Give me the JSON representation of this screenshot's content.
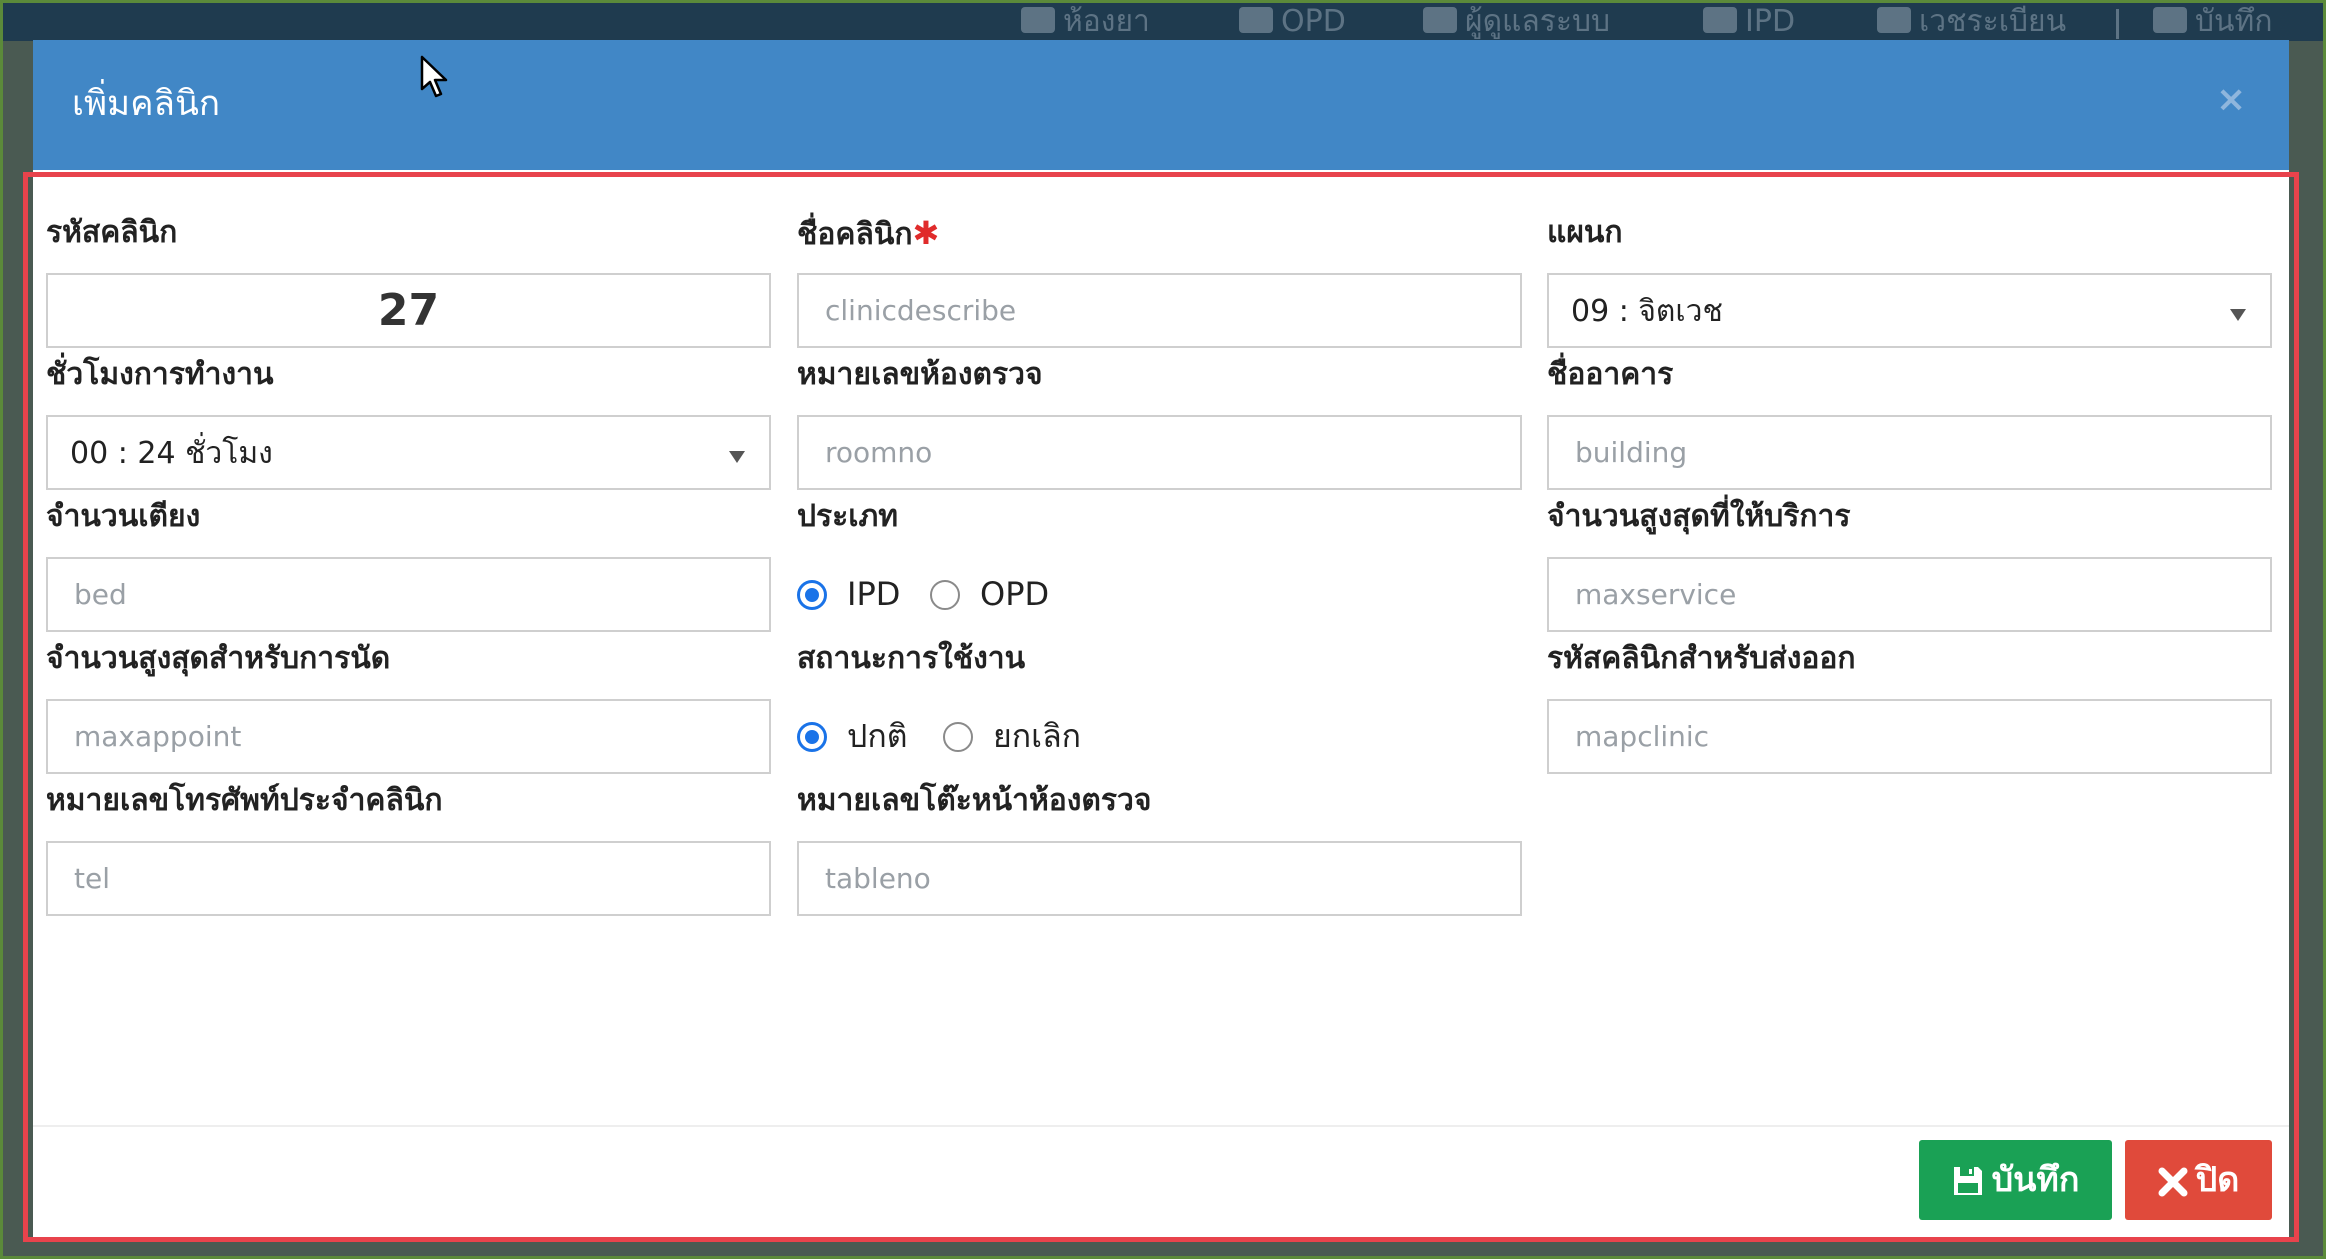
{
  "background": {
    "nav": [
      {
        "label": "ห้องยา",
        "icon": "medical-icon"
      },
      {
        "label": "OPD",
        "icon": "users-icon"
      },
      {
        "label": "ผู้ดูแลระบบ",
        "icon": "gears-icon"
      },
      {
        "label": "IPD",
        "icon": "bed-icon"
      },
      {
        "label": "เวชระเบียน",
        "icon": "card-icon"
      },
      {
        "label": "บันทึก",
        "icon": "save-icon"
      }
    ]
  },
  "modal": {
    "title": "เพิ่มคลินิก",
    "close_symbol": "×"
  },
  "form": {
    "clinic_code": {
      "label": "รหัสคลินิก",
      "value": "27"
    },
    "clinic_name": {
      "label": "ชื่อคลินิก",
      "required_mark": "✱",
      "placeholder": "clinicdescribe"
    },
    "department": {
      "label": "แผนก",
      "value": "09 : จิตเวช"
    },
    "work_hours": {
      "label": "ชั่วโมงการทำงาน",
      "value": "00 : 24 ชั่วโมง"
    },
    "room_no": {
      "label": "หมายเลขห้องตรวจ",
      "placeholder": "roomno"
    },
    "building": {
      "label": "ชื่ออาคาร",
      "placeholder": "building"
    },
    "bed": {
      "label": "จำนวนเตียง",
      "placeholder": "bed"
    },
    "type": {
      "label": "ประเภท",
      "options": [
        "IPD",
        "OPD"
      ],
      "selected": "IPD"
    },
    "max_service": {
      "label": "จำนวนสูงสุดที่ให้บริการ",
      "placeholder": "maxservice"
    },
    "max_appoint": {
      "label": "จำนวนสูงสุดสำหรับการนัด",
      "placeholder": "maxappoint"
    },
    "status": {
      "label": "สถานะการใช้งาน",
      "options": [
        "ปกติ",
        "ยกเลิก"
      ],
      "selected": "ปกติ"
    },
    "export_code": {
      "label": "รหัสคลินิกสำหรับส่งออก",
      "placeholder": "mapclinic"
    },
    "tel": {
      "label": "หมายเลขโทรศัพท์ประจำคลินิก",
      "placeholder": "tel"
    },
    "table_no": {
      "label": "หมายเลขโต๊ะหน้าห้องตรวจ",
      "placeholder": "tableno"
    }
  },
  "buttons": {
    "save": "บันทึก",
    "close": "ปิด"
  },
  "colors": {
    "header": "#4187c6",
    "save": "#1aa155",
    "close": "#e04a3b",
    "highlight": "#e8434c",
    "radio": "#1a73e8"
  }
}
